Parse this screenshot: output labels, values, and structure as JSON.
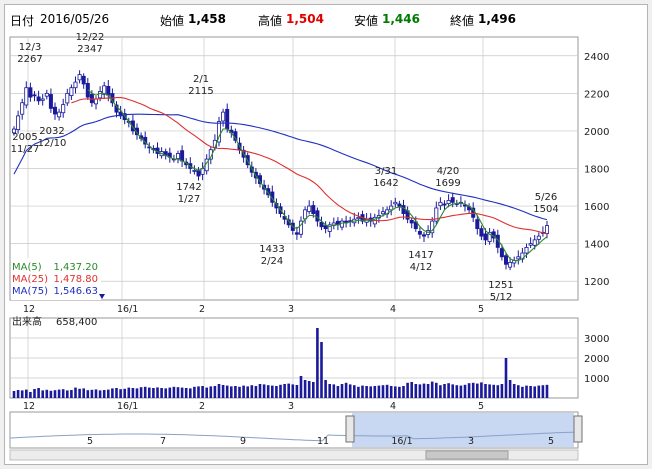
{
  "header": {
    "date_label": "日付",
    "date": "2016/05/26",
    "open_label": "始値",
    "open": "1,458",
    "high_label": "高値",
    "high": "1,504",
    "low_label": "安値",
    "low": "1,446",
    "close_label": "終値",
    "close": "1,496"
  },
  "legend": [
    {
      "name": "MA(5)",
      "value": "1,437.20",
      "color": "#2a8a2a"
    },
    {
      "name": "MA(25)",
      "value": "1,478.80",
      "color": "#e03030"
    },
    {
      "name": "MA(75)",
      "value": "1,546.63",
      "color": "#2030c0"
    }
  ],
  "volume_label": "出来高",
  "volume_value": "658,400",
  "colors": {
    "candle": "#1a1a9a",
    "volume": "#1a1a9a",
    "ma5": "#2a8a2a",
    "ma25": "#e03030",
    "ma75": "#2030c0",
    "grid": "#c8c8c8"
  },
  "chart_data": [
    {
      "type": "candlestick",
      "ylim": [
        1100,
        2500
      ],
      "yticks": [
        "1200",
        "1400",
        "1600",
        "1800",
        "2000",
        "2200",
        "2400"
      ],
      "xticks": [
        "12",
        "16/1",
        "2",
        "3",
        "4",
        "5"
      ],
      "annotations": [
        {
          "date": "12/3",
          "value": "2267"
        },
        {
          "date": "12/22",
          "value": "2347"
        },
        {
          "date": "11/27",
          "value": "2005"
        },
        {
          "date": "12/10",
          "value": "2032"
        },
        {
          "date": "2/1",
          "value": "2115"
        },
        {
          "date": "1/27",
          "value": "1742"
        },
        {
          "date": "2/24",
          "value": "1433"
        },
        {
          "date": "3/31",
          "value": "1642"
        },
        {
          "date": "4/20",
          "value": "1699"
        },
        {
          "date": "4/12",
          "value": "1417"
        },
        {
          "date": "5/12",
          "value": "1251"
        },
        {
          "date": "5/26",
          "value": "1504"
        }
      ],
      "close_series": [
        2010,
        2080,
        2150,
        2230,
        2180,
        2190,
        2160,
        2170,
        2200,
        2120,
        2090,
        2100,
        2140,
        2200,
        2230,
        2260,
        2300,
        2250,
        2180,
        2150,
        2170,
        2210,
        2240,
        2190,
        2150,
        2100,
        2080,
        2060,
        2050,
        2000,
        1980,
        1960,
        1930,
        1910,
        1900,
        1880,
        1890,
        1870,
        1860,
        1850,
        1880,
        1840,
        1820,
        1800,
        1790,
        1760,
        1800,
        1850,
        1900,
        1950,
        2050,
        2100,
        2010,
        1990,
        1950,
        1900,
        1860,
        1820,
        1780,
        1750,
        1720,
        1690,
        1660,
        1620,
        1590,
        1560,
        1530,
        1500,
        1470,
        1450,
        1520,
        1580,
        1600,
        1560,
        1520,
        1490,
        1480,
        1500,
        1510,
        1500,
        1520,
        1510,
        1520,
        1530,
        1540,
        1520,
        1530,
        1520,
        1540,
        1550,
        1570,
        1580,
        1600,
        1620,
        1600,
        1560,
        1530,
        1510,
        1480,
        1450,
        1440,
        1470,
        1520,
        1590,
        1620,
        1610,
        1630,
        1620,
        1610,
        1620,
        1600,
        1580,
        1540,
        1480,
        1440,
        1420,
        1460,
        1430,
        1380,
        1330,
        1290,
        1300,
        1310,
        1330,
        1350,
        1380,
        1400,
        1420,
        1440,
        1460,
        1496
      ],
      "ma5": [
        2030,
        2060,
        2100,
        2140,
        2150,
        2170,
        2170,
        2180,
        2170,
        2150,
        2130,
        2120,
        2140,
        2170,
        2200,
        2230,
        2250,
        2240,
        2220,
        2200,
        2190,
        2200,
        2200,
        2190,
        2160,
        2130,
        2110,
        2080,
        2050,
        2020,
        1990,
        1960,
        1940,
        1920,
        1900,
        1890,
        1880,
        1870,
        1860,
        1850,
        1850,
        1840,
        1830,
        1810,
        1800,
        1790,
        1800,
        1830,
        1860,
        1910,
        1970,
        2010,
        2010,
        1990,
        1960,
        1920,
        1880,
        1840,
        1800,
        1760,
        1730,
        1700,
        1670,
        1640,
        1610,
        1580,
        1550,
        1520,
        1490,
        1480,
        1500,
        1530,
        1550,
        1550,
        1540,
        1520,
        1500,
        1490,
        1500,
        1500,
        1510,
        1510,
        1515,
        1520,
        1525,
        1525,
        1525,
        1525,
        1530,
        1540,
        1550,
        1560,
        1575,
        1590,
        1595,
        1590,
        1575,
        1550,
        1520,
        1490,
        1470,
        1460,
        1470,
        1500,
        1540,
        1580,
        1600,
        1610,
        1615,
        1615,
        1610,
        1600,
        1580,
        1550,
        1510,
        1470,
        1450,
        1440,
        1420,
        1390,
        1350,
        1320,
        1310,
        1310,
        1320,
        1340,
        1360,
        1380,
        1400,
        1420,
        1437
      ]
    },
    {
      "type": "bar",
      "name": "出来高",
      "ylim": [
        0,
        4000
      ],
      "yticks": [
        "1000",
        "2000",
        "3000"
      ],
      "xticks": [
        "12",
        "16/1",
        "2",
        "3",
        "4",
        "5"
      ],
      "values": [
        350,
        400,
        380,
        420,
        300,
        450,
        500,
        380,
        410,
        360,
        390,
        420,
        440,
        380,
        400,
        520,
        460,
        480,
        390,
        410,
        430,
        380,
        400,
        420,
        480,
        500,
        440,
        460,
        520,
        500,
        480,
        540,
        560,
        520,
        500,
        530,
        500,
        480,
        520,
        560,
        540,
        520,
        500,
        480,
        560,
        580,
        600,
        520,
        580,
        600,
        700,
        650,
        620,
        580,
        600,
        560,
        620,
        580,
        640,
        600,
        700,
        680,
        640,
        620,
        600,
        660,
        700,
        720,
        680,
        650,
        1100,
        900,
        850,
        800,
        3500,
        2800,
        900,
        700,
        680,
        600,
        700,
        760,
        680,
        640,
        560,
        620,
        600,
        580,
        600,
        620,
        640,
        660,
        600,
        580,
        560,
        600,
        760,
        800,
        700,
        680,
        720,
        700,
        820,
        760,
        640,
        700,
        740,
        680,
        640,
        620,
        660,
        740,
        760,
        720,
        780,
        700,
        680,
        660,
        640,
        700,
        2000,
        900,
        700,
        640,
        560,
        620,
        600,
        580,
        620,
        640,
        658
      ]
    }
  ],
  "xtick_labels_main": [
    "12",
    "16/1",
    "2",
    "3",
    "4",
    "5"
  ],
  "navigator": {
    "ticks": [
      "5",
      "7",
      "9",
      "11",
      "16/1",
      "3",
      "5"
    ]
  }
}
